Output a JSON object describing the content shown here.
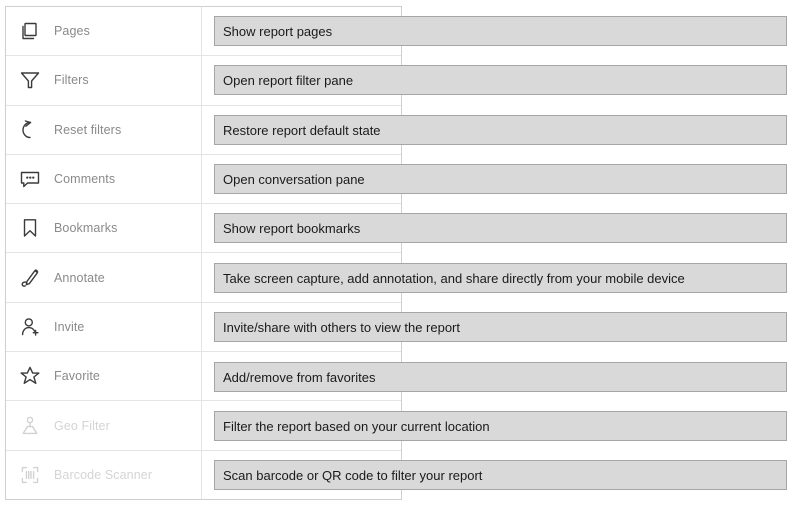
{
  "table": {
    "rows": [
      {
        "icon": "pages-icon",
        "label": "Pages",
        "enabled": true,
        "tooltip": "Show report pages"
      },
      {
        "icon": "funnel-filter-icon",
        "label": "Filters",
        "enabled": true,
        "tooltip": "Open report filter pane"
      },
      {
        "icon": "reset-undo-icon",
        "label": "Reset filters",
        "enabled": true,
        "tooltip": "Restore report default state"
      },
      {
        "icon": "comments-icon",
        "label": "Comments",
        "enabled": true,
        "tooltip": "Open conversation pane"
      },
      {
        "icon": "bookmark-icon",
        "label": "Bookmarks",
        "enabled": true,
        "tooltip": "Show report bookmarks"
      },
      {
        "icon": "annotate-pen-icon",
        "label": "Annotate",
        "enabled": true,
        "tooltip": "Take screen capture, add annotation, and share directly from your mobile device"
      },
      {
        "icon": "invite-person-add-icon",
        "label": "Invite",
        "enabled": true,
        "tooltip": "Invite/share with others to view the report"
      },
      {
        "icon": "favorite-star-icon",
        "label": "Favorite",
        "enabled": true,
        "tooltip": "Add/remove from favorites"
      },
      {
        "icon": "geo-filter-pin-icon",
        "label": "Geo Filter",
        "enabled": false,
        "tooltip": "Filter the report based on your current location"
      },
      {
        "icon": "barcode-scanner-icon",
        "label": "Barcode Scanner",
        "enabled": false,
        "tooltip": "Scan barcode or QR code to filter your report"
      }
    ]
  },
  "colors": {
    "callout_fill": "#d9d9d9",
    "callout_border": "#a6a6a6",
    "label_text": "#8a8a8a",
    "label_text_disabled": "#d4d4d4",
    "icon_stroke": "#3b3b3b",
    "icon_stroke_disabled": "#d2d2d2",
    "table_border": "#cfcfcf",
    "row_divider": "#e4e4e4"
  }
}
